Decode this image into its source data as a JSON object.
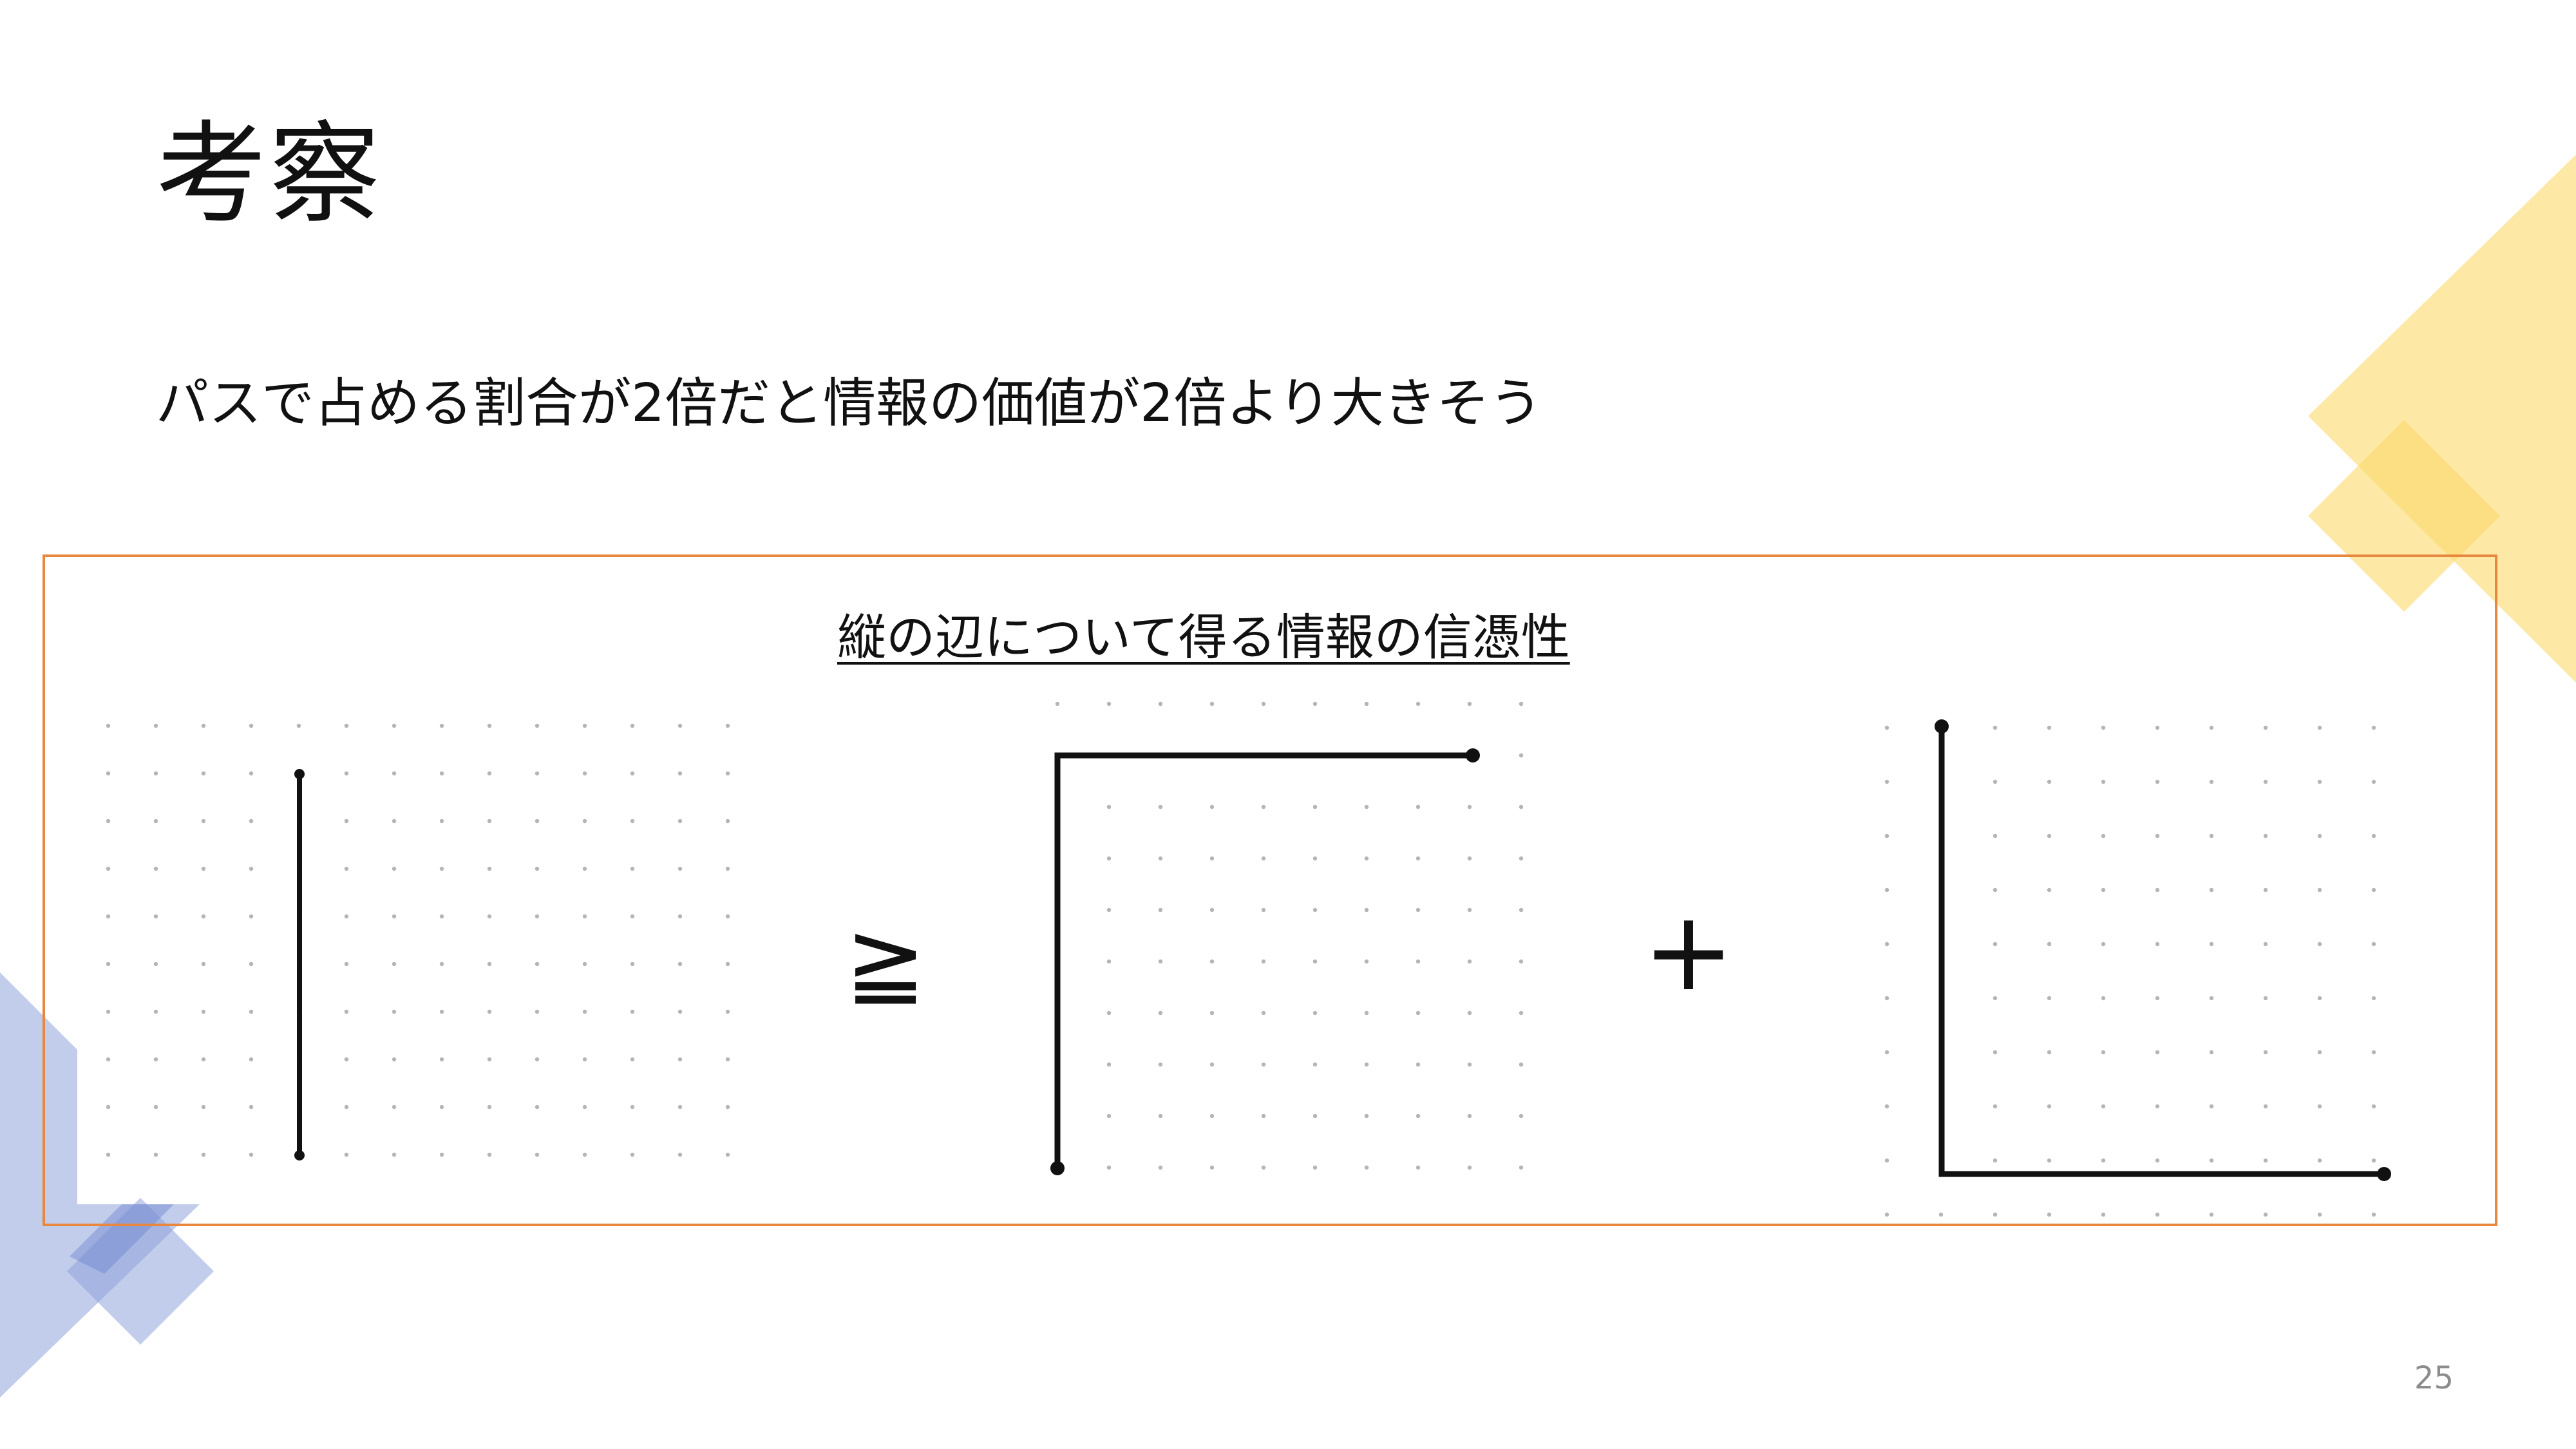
{
  "slide": {
    "title": "考察",
    "subtitle": "パスで占める割合が2倍だと情報の価値が2倍より大きそう",
    "panel_caption": "縦の辺について得る情報の信憑性",
    "operator_geq": "≧",
    "operator_plus": "+",
    "page_number": "25"
  },
  "colors": {
    "accent_yellow": "#fbd96a",
    "accent_blue": "#9aaee0",
    "panel_border": "#e8873d"
  }
}
